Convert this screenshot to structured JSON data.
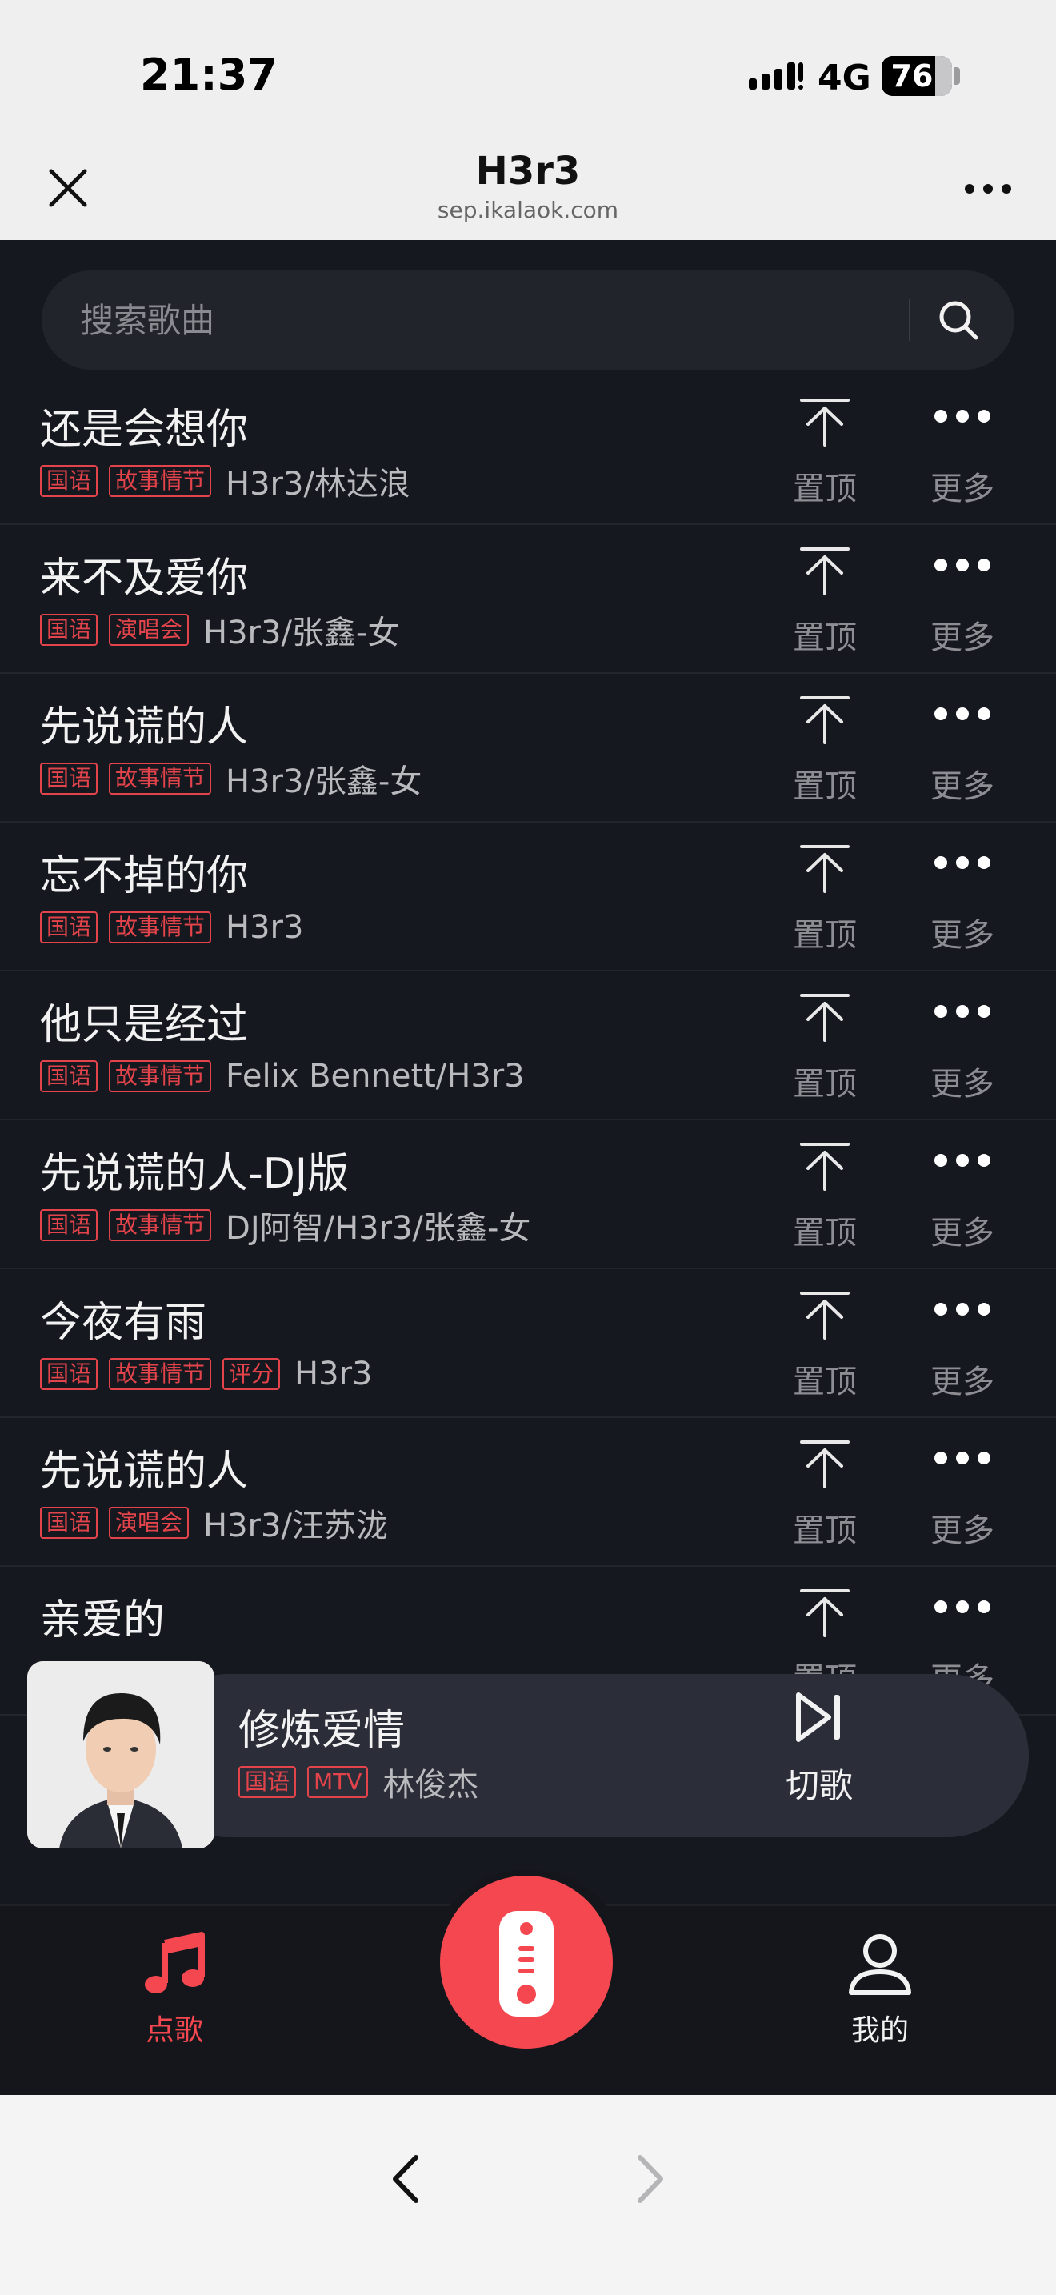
{
  "status_bar": {
    "time": "21:37",
    "network": "4G",
    "battery": "76",
    "battery_level": 0.76
  },
  "title_bar": {
    "title": "H3r3",
    "subtitle": "sep.ikalaok.com"
  },
  "search": {
    "placeholder": "搜索歌曲"
  },
  "labels": {
    "top": "置顶",
    "more": "更多"
  },
  "songs": [
    {
      "title": "还是会想你",
      "tags": [
        "国语",
        "故事情节"
      ],
      "artist": "H3r3/林达浪"
    },
    {
      "title": "来不及爱你",
      "tags": [
        "国语",
        "演唱会"
      ],
      "artist": "H3r3/张鑫-女"
    },
    {
      "title": "先说谎的人",
      "tags": [
        "国语",
        "故事情节"
      ],
      "artist": "H3r3/张鑫-女"
    },
    {
      "title": "忘不掉的你",
      "tags": [
        "国语",
        "故事情节"
      ],
      "artist": "H3r3"
    },
    {
      "title": "他只是经过",
      "tags": [
        "国语",
        "故事情节"
      ],
      "artist": "Felix Bennett/H3r3"
    },
    {
      "title": "先说谎的人-DJ版",
      "tags": [
        "国语",
        "故事情节"
      ],
      "artist": "DJ阿智/H3r3/张鑫-女"
    },
    {
      "title": "今夜有雨",
      "tags": [
        "国语",
        "故事情节",
        "评分"
      ],
      "artist": "H3r3"
    },
    {
      "title": "先说谎的人",
      "tags": [
        "国语",
        "演唱会"
      ],
      "artist": "H3r3/汪苏泷"
    },
    {
      "title": "亲爱的",
      "tags": [],
      "artist": ""
    }
  ],
  "now_playing": {
    "title": "修炼爱情",
    "tags": [
      "国语",
      "MTV"
    ],
    "artist": "林俊杰",
    "skip_label": "切歌"
  },
  "tabs": {
    "songs_label": "点歌",
    "mine_label": "我的"
  },
  "colors": {
    "accent": "#f4474f",
    "tag": "#e3434a",
    "background": "#16181f"
  },
  "icons": [
    "close-icon",
    "more-icon",
    "search-icon",
    "pin-top-icon",
    "dots-icon",
    "skip-next-icon",
    "music-note-icon",
    "remote-icon",
    "user-icon",
    "back-icon",
    "forward-icon"
  ]
}
